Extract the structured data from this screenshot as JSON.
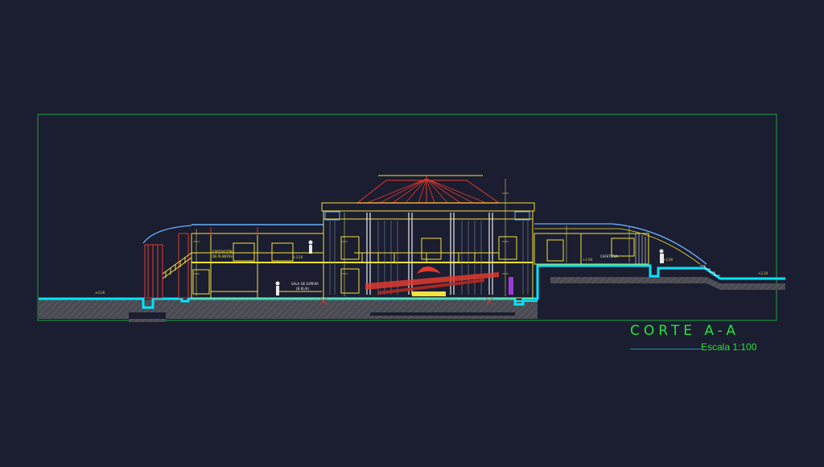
{
  "drawing": {
    "title": "CORTE A-A",
    "scale": "Escala 1:100"
  },
  "labels": {
    "exposicion_line1": "EXPOSICIÓN",
    "exposicion_line2": "DE PLANTAS",
    "sala_line1": "SALA DE ESPERA",
    "sala_line2": "(B.KLAI)",
    "cafeteria": "CAFETERIA",
    "level_left": "±0.00",
    "level_mezz": "+3.20",
    "level_right": "+2.60",
    "level_right2": "+2.80",
    "level_far": "+2.20"
  },
  "colors": {
    "background": "#1b1d30",
    "ground": "#00e5ff",
    "walls": "#f0e13c",
    "structure": "#e23a2f",
    "frame": "#19a83a",
    "dim": "#d8d25a",
    "title": "#22e63a"
  }
}
